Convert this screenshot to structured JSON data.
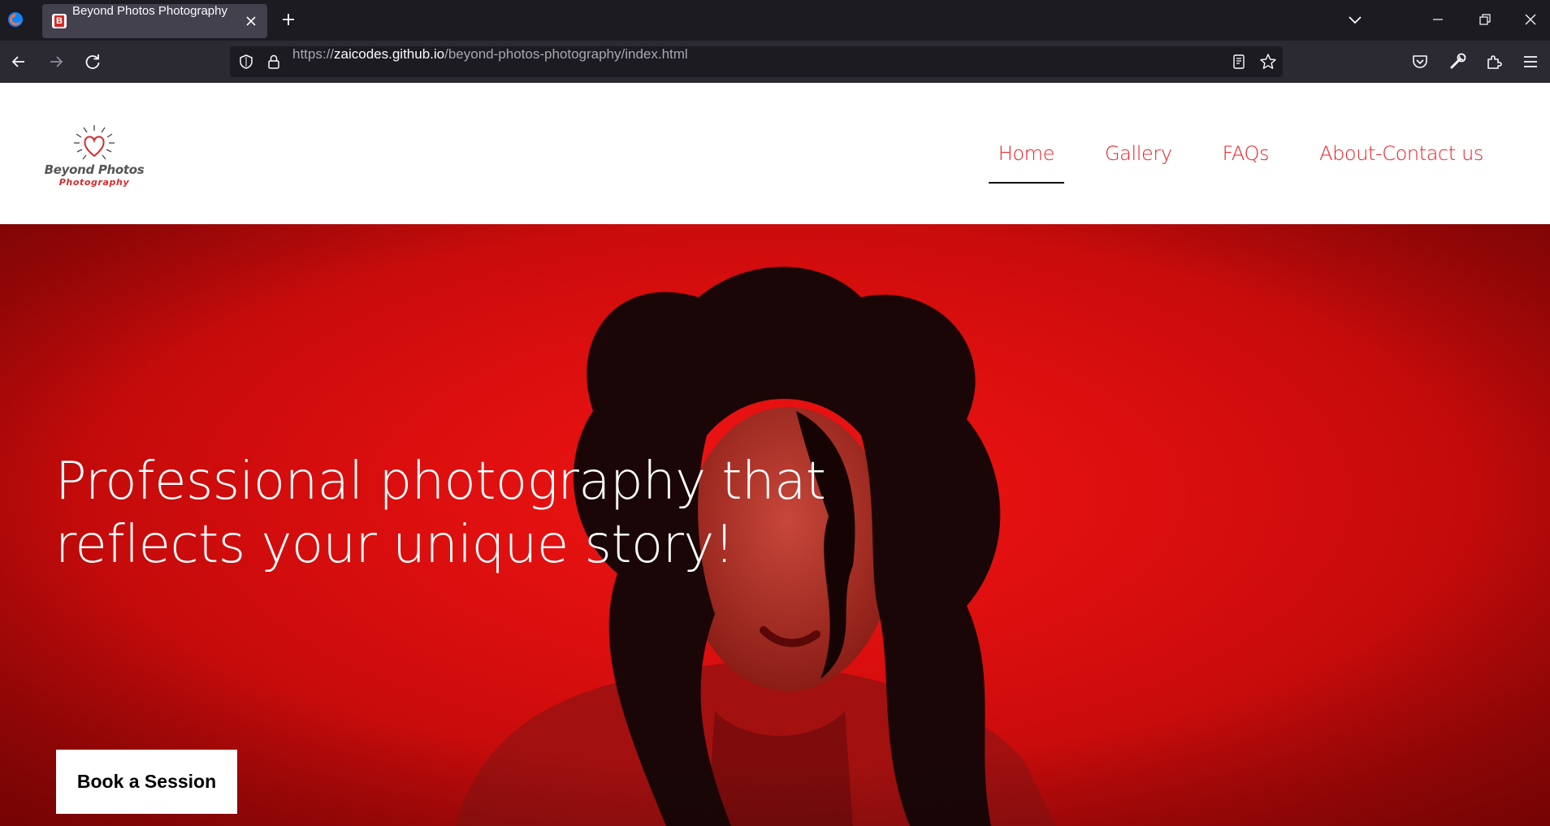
{
  "browser": {
    "tab_title": "Beyond Photos Photography",
    "favicon_letter": "B",
    "url_scheme": "https://",
    "url_host": "zaicodes.github.io",
    "url_path": "/beyond-photos-photography/index.html"
  },
  "site": {
    "logo": {
      "name": "Beyond Photos",
      "tagline": "Photography"
    },
    "nav": [
      {
        "label": "Home",
        "active": true
      },
      {
        "label": "Gallery",
        "active": false
      },
      {
        "label": "FAQs",
        "active": false
      },
      {
        "label": "About-Contact us",
        "active": false
      }
    ],
    "hero": {
      "title_line1": "Professional photography that",
      "title_line2": "reflects your unique story!",
      "cta_label": "Book a Session"
    }
  },
  "colors": {
    "accent": "#ef1c24",
    "hero_background": "#d40d0d",
    "chrome_dark": "#1c1b22",
    "chrome_toolbar": "#2b2a33",
    "tab_active": "#42414d"
  },
  "icons": {
    "browser": "firefox-icon",
    "tab_close": "close-icon",
    "new_tab": "plus-icon",
    "tab_list": "chevron-down-icon",
    "back": "arrow-left-icon",
    "forward": "arrow-right-icon",
    "reload": "reload-icon",
    "tracking": "shield-icon",
    "secure": "lock-icon",
    "reader": "reader-view-icon",
    "bookmark": "star-icon",
    "pocket": "pocket-icon",
    "tools": "wrench-icon",
    "extensions": "puzzle-icon",
    "menu": "hamburger-menu-icon"
  }
}
